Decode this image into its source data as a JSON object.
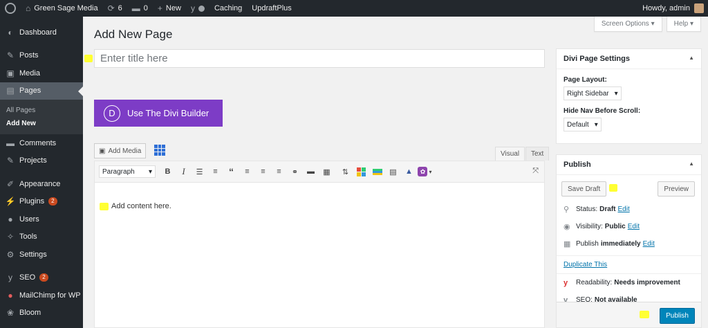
{
  "adminbar": {
    "site_name": "Green Sage Media",
    "updates_count": "6",
    "comments_count": "0",
    "new_label": "New",
    "caching_label": "Caching",
    "updraft_label": "UpdraftPlus",
    "greeting": "Howdy, admin"
  },
  "sidebar": {
    "items": [
      {
        "label": "Dashboard",
        "icon": "dashboard-icon"
      },
      {
        "label": "Posts",
        "icon": "pin-icon"
      },
      {
        "label": "Media",
        "icon": "media-icon"
      },
      {
        "label": "Pages",
        "icon": "pages-icon"
      },
      {
        "label": "Comments",
        "icon": "comment-icon"
      },
      {
        "label": "Projects",
        "icon": "pin-icon"
      },
      {
        "label": "Appearance",
        "icon": "brush-icon"
      },
      {
        "label": "Plugins",
        "icon": "plug-icon",
        "badge": "2"
      },
      {
        "label": "Users",
        "icon": "user-icon"
      },
      {
        "label": "Tools",
        "icon": "wrench-icon"
      },
      {
        "label": "Settings",
        "icon": "settings-icon"
      },
      {
        "label": "SEO",
        "icon": "yoast-icon",
        "badge": "2"
      },
      {
        "label": "MailChimp for WP",
        "icon": "mailchimp-icon"
      },
      {
        "label": "Bloom",
        "icon": "bloom-icon"
      }
    ],
    "submenu": [
      "All Pages",
      "Add New"
    ]
  },
  "screen_options_label": "Screen Options",
  "help_label": "Help",
  "page_title": "Add New Page",
  "title_placeholder": "Enter title here",
  "divi_button_label": "Use The Divi Builder",
  "divi_letter": "D",
  "editor": {
    "add_media_label": "Add Media",
    "tab_visual": "Visual",
    "tab_text": "Text",
    "format_select": "Paragraph",
    "content": "Add content here."
  },
  "divi_settings": {
    "title": "Divi Page Settings",
    "layout_label": "Page Layout:",
    "layout_value": "Right Sidebar",
    "nav_label": "Hide Nav Before Scroll:",
    "nav_value": "Default"
  },
  "publish": {
    "title": "Publish",
    "save_draft": "Save Draft",
    "preview": "Preview",
    "status_label": "Status:",
    "status_value": "Draft",
    "visibility_label": "Visibility:",
    "visibility_value": "Public",
    "publish_label": "Publish",
    "publish_value": "immediately",
    "edit": "Edit",
    "duplicate": "Duplicate This",
    "readability_label": "Readability:",
    "readability_value": "Needs improvement",
    "seo_label": "SEO:",
    "seo_value": "Not available",
    "publish_button": "Publish"
  },
  "colors": {
    "admin_dark": "#23282d",
    "divi_purple": "#7d3cc6",
    "publish_blue": "#0085ba",
    "highlight": "#ffff33"
  }
}
